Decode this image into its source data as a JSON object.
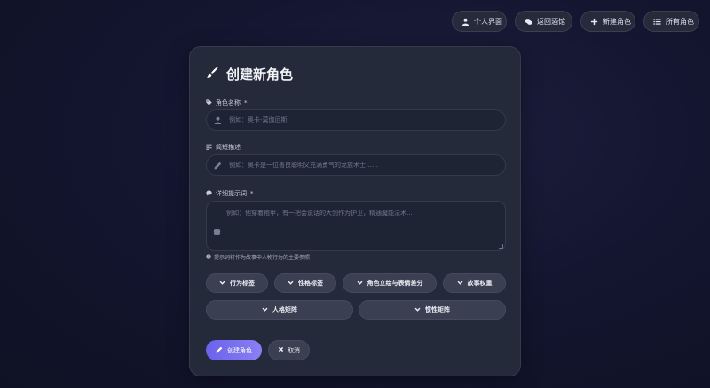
{
  "nav": {
    "items": [
      {
        "label": "个人界面",
        "icon": "user-icon"
      },
      {
        "label": "返回酒馆",
        "icon": "chat-icon"
      },
      {
        "label": "新建角色",
        "icon": "plus-icon"
      },
      {
        "label": "所有角色",
        "icon": "list-icon"
      }
    ]
  },
  "form": {
    "title": "创建新角色",
    "name": {
      "label": "角色名称",
      "required": "*",
      "placeholder": "例如：奥卡-莫伽厄斯"
    },
    "short_desc": {
      "label": "简短描述",
      "placeholder": "例如：奥卡是一位善良聪明又充满勇气的龙族术士……"
    },
    "prompt": {
      "label": "详细提示词",
      "required": "*",
      "placeholder": "例如：他穿着袍甲，有一把会说话的大剑作为护卫，精通魔能法术..."
    },
    "hint": "提示词将作为故事中人物行为的主要参照"
  },
  "sections": {
    "row1": [
      "行为标签",
      "性格标签",
      "角色立绘与表情差分",
      "故事权重"
    ],
    "row2": [
      "人格矩阵",
      "惯性矩阵"
    ]
  },
  "actions": {
    "create": "创建角色",
    "cancel": "取消"
  },
  "colors": {
    "accent": "#7a70f2",
    "card": "#252a3a",
    "background": "#141631"
  }
}
